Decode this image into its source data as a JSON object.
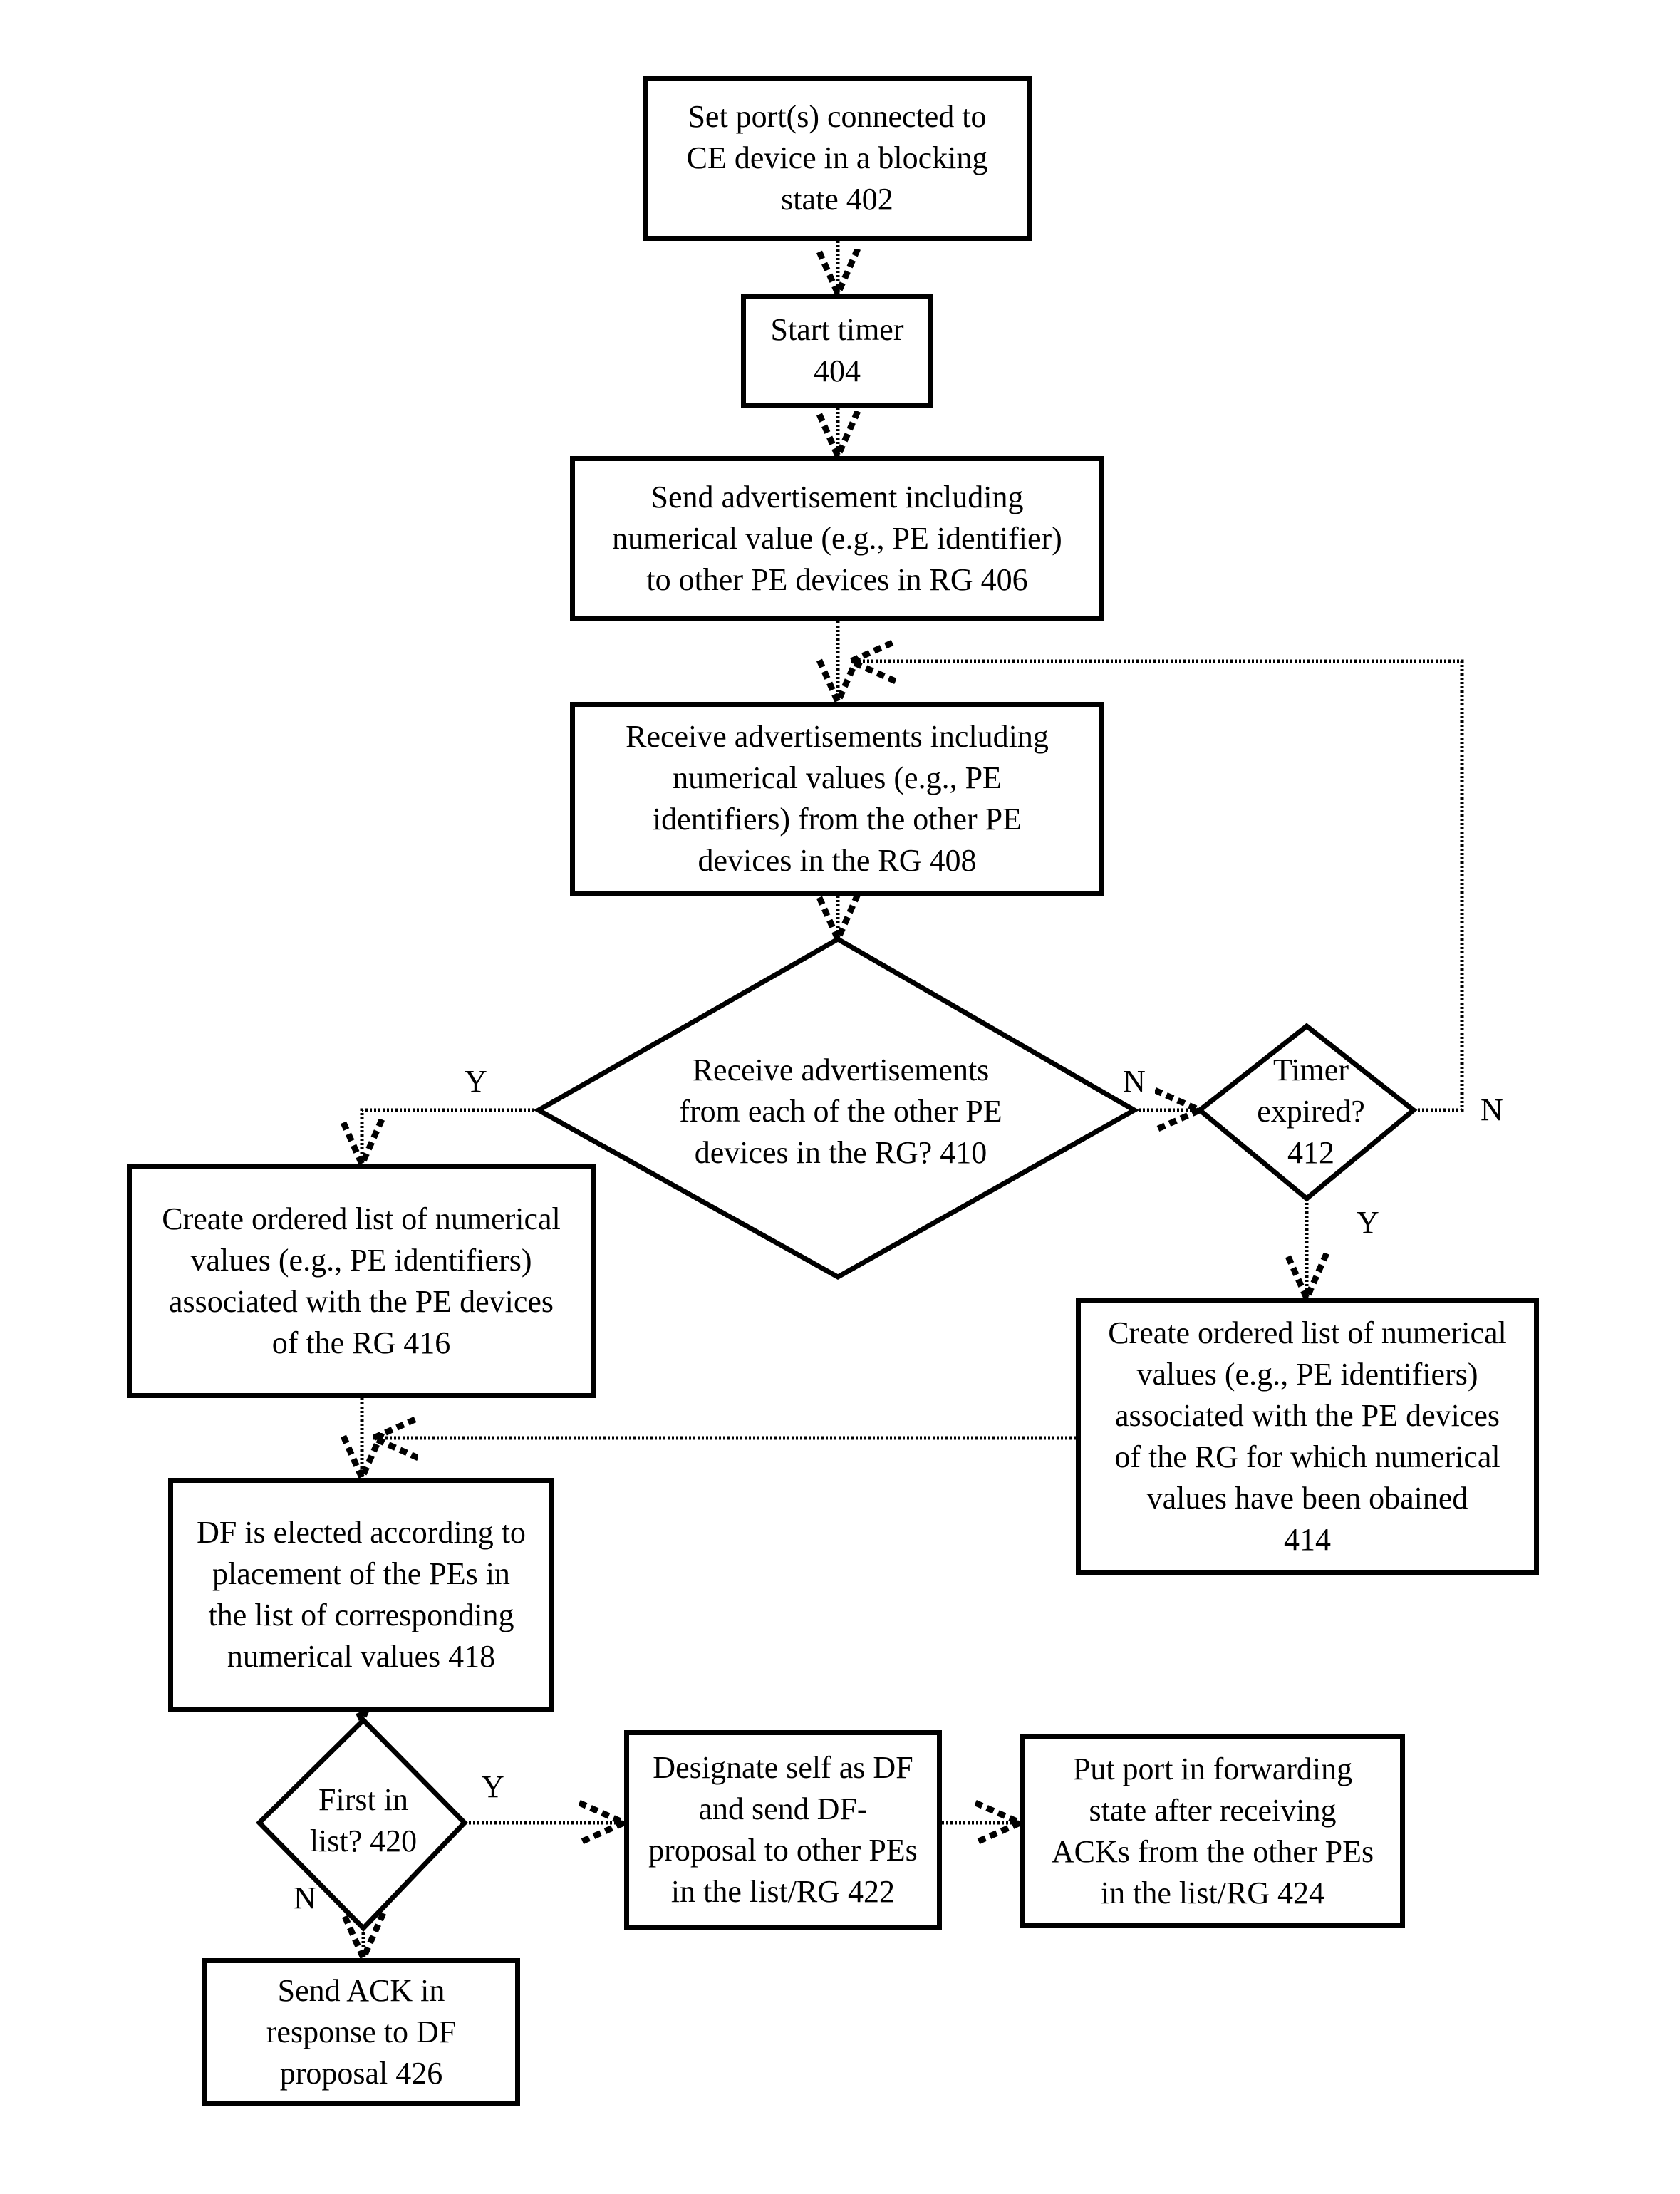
{
  "figure": {
    "nodes": {
      "n402": {
        "text": "Set port(s) connected to\nCE device in a blocking\nstate  402"
      },
      "n404": {
        "text": "Start timer\n404"
      },
      "n406": {
        "text": "Send advertisement including\nnumerical value (e.g., PE identifier)\nto other PE devices in RG 406"
      },
      "n408": {
        "text": "Receive advertisements including\nnumerical values (e.g., PE\nidentifiers) from the other PE\ndevices in the RG  408"
      },
      "n410": {
        "text": "Receive advertisements\nfrom each of the other PE\ndevices in the RG? 410"
      },
      "n412": {
        "text": "Timer\nexpired?\n412"
      },
      "n414": {
        "text": "Create ordered list of numerical\nvalues (e.g., PE identifiers)\nassociated with the PE devices\nof the RG for which numerical\nvalues have been obained\n414"
      },
      "n416": {
        "text": "Create ordered list of numerical\nvalues (e.g., PE identifiers)\nassociated with the PE devices\nof the RG 416"
      },
      "n418": {
        "text": "DF is elected according to\nplacement of the PEs in\nthe list of corresponding\nnumerical values 418"
      },
      "n420": {
        "text": "First in\nlist? 420"
      },
      "n422": {
        "text": "Designate self as DF\nand send DF-\nproposal to other PEs\nin the list/RG 422"
      },
      "n424": {
        "text": "Put port in forwarding\nstate after receiving\nACKs from the other PEs\nin the list/RG 424"
      },
      "n426": {
        "text": "Send ACK in\nresponse to DF\nproposal 426"
      }
    },
    "edge_labels": {
      "y410": "Y",
      "n410": "N",
      "n412": "N",
      "y412": "Y",
      "y420": "Y",
      "n420": "N"
    },
    "edges": [
      {
        "from": "402",
        "to": "404"
      },
      {
        "from": "404",
        "to": "406"
      },
      {
        "from": "406",
        "to": "408"
      },
      {
        "from": "408",
        "to": "410"
      },
      {
        "from": "410",
        "to": "416",
        "label": "Y"
      },
      {
        "from": "410",
        "to": "412",
        "label": "N"
      },
      {
        "from": "412",
        "to": "408",
        "label": "N"
      },
      {
        "from": "412",
        "to": "414",
        "label": "Y"
      },
      {
        "from": "416",
        "to": "418"
      },
      {
        "from": "414",
        "to": "418"
      },
      {
        "from": "418",
        "to": "420"
      },
      {
        "from": "420",
        "to": "422",
        "label": "Y"
      },
      {
        "from": "420",
        "to": "426",
        "label": "N"
      },
      {
        "from": "422",
        "to": "424"
      }
    ]
  }
}
